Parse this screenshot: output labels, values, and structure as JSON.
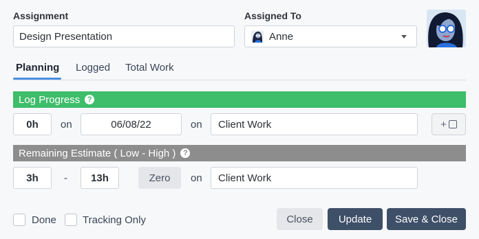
{
  "assignment": {
    "label": "Assignment",
    "value": "Design Presentation"
  },
  "assigned_to": {
    "label": "Assigned To",
    "value": "Anne",
    "dropdown_icon": "caret-down-icon"
  },
  "tabs": [
    {
      "label": "Planning",
      "active": true
    },
    {
      "label": "Logged",
      "active": false
    },
    {
      "label": "Total Work",
      "active": false
    }
  ],
  "log_progress": {
    "title": "Log Progress",
    "help_icon": "?",
    "hours": "0h",
    "on1": "on",
    "date": "06/08/22",
    "on2": "on",
    "category": "Client Work",
    "add_note_label": "+",
    "color": "#3ebd6a"
  },
  "remaining": {
    "title": "Remaining Estimate ( Low - High )",
    "help_icon": "?",
    "low": "3h",
    "dash": "-",
    "high": "13h",
    "zero_label": "Zero",
    "on": "on",
    "category": "Client Work",
    "color": "#8d8d8d"
  },
  "footer": {
    "done_label": "Done",
    "tracking_label": "Tracking Only",
    "close_label": "Close",
    "update_label": "Update",
    "save_close_label": "Save & Close",
    "button_color": "#3e4f68"
  }
}
